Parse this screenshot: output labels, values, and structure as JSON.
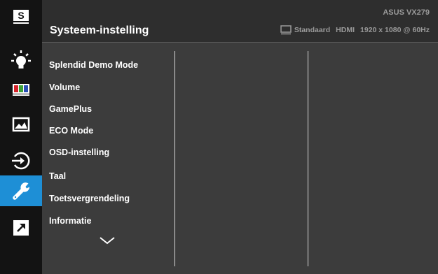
{
  "sidebar": {
    "items": [
      {
        "icon": "splendid-s-icon",
        "label": "S"
      },
      {
        "icon": "brightness-icon"
      },
      {
        "icon": "color-icon"
      },
      {
        "icon": "image-icon"
      },
      {
        "icon": "input-select-icon"
      },
      {
        "icon": "wrench-icon",
        "active": true
      },
      {
        "icon": "shortcut-icon"
      }
    ],
    "accent_color": "#1e8fd6"
  },
  "header": {
    "title": "Systeem-instelling",
    "model": "ASUS VX279",
    "mode": "Standaard",
    "input": "HDMI",
    "resolution": "1920 x 1080 @ 60Hz"
  },
  "menu": {
    "items": [
      {
        "label": "Splendid Demo Mode"
      },
      {
        "label": "Volume"
      },
      {
        "label": "GamePlus"
      },
      {
        "label": "ECO Mode"
      },
      {
        "label": "OSD-instelling"
      },
      {
        "label": "Taal"
      },
      {
        "label": "Toetsvergrendeling"
      },
      {
        "label": "Informatie"
      }
    ],
    "more_icon": "chevron-down-icon"
  }
}
